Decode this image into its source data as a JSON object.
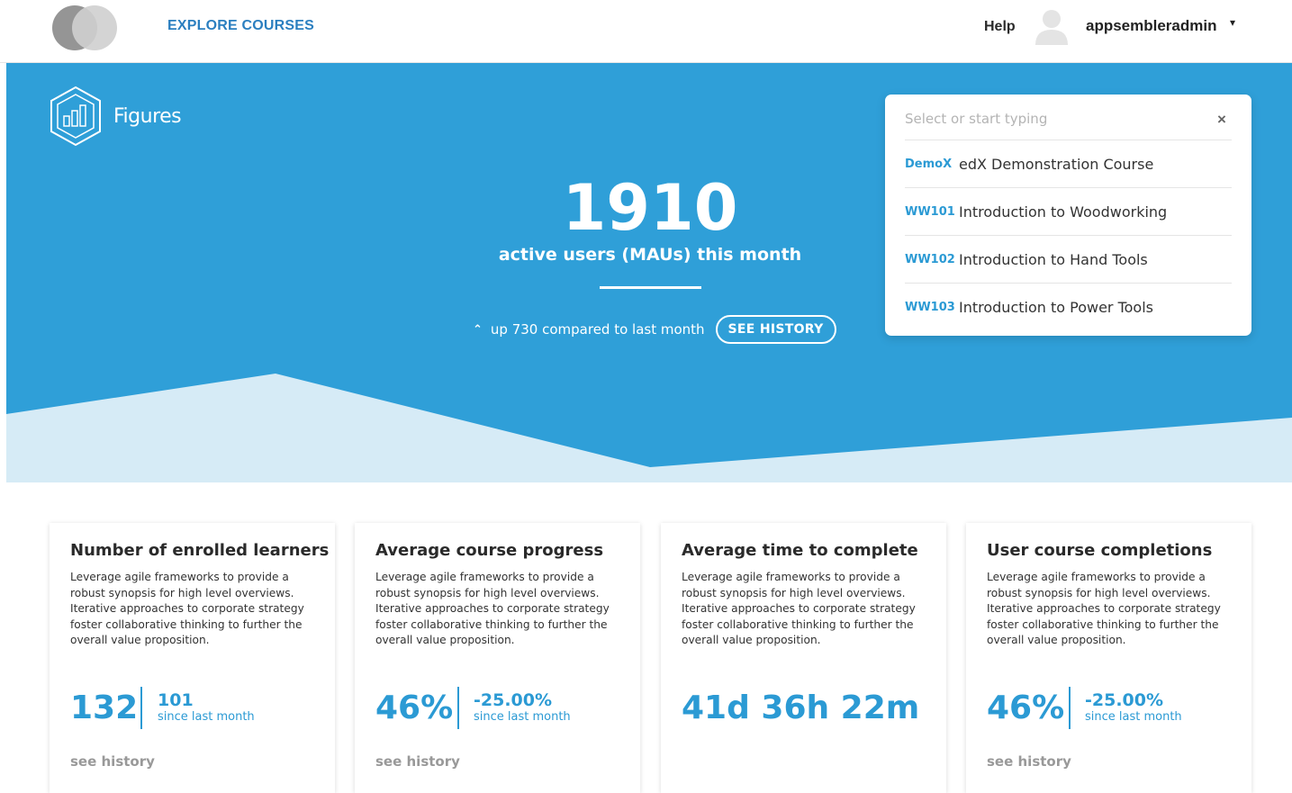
{
  "nav": {
    "explore": "EXPLORE COURSES",
    "help": "Help",
    "username": "appsembleradmin",
    "caret": "▾"
  },
  "hero": {
    "brand": "Figures",
    "mau_value": "1910",
    "mau_label": "active users (MAUs) this month",
    "compare_arrow": "⌃",
    "compare_text": "up 730 compared to last month",
    "see_history": "SEE HISTORY"
  },
  "course_select": {
    "placeholder": "Select or start typing",
    "close": "×",
    "items": [
      {
        "code": "DemoX",
        "name": "edX Demonstration Course"
      },
      {
        "code": "WW101",
        "name": "Introduction to Woodworking"
      },
      {
        "code": "WW102",
        "name": "Introduction to Hand Tools"
      },
      {
        "code": "WW103",
        "name": "Introduction to Power Tools"
      }
    ]
  },
  "cards": [
    {
      "title": "Number of enrolled learners",
      "desc": "Leverage agile frameworks to provide a robust synopsis for high level overviews. Iterative approaches to corporate strategy foster collaborative thinking to further the overall value proposition.",
      "value": "132",
      "delta": "101",
      "delta_label": "since last month",
      "history": "see history"
    },
    {
      "title": "Average course progress",
      "desc": "Leverage agile frameworks to provide a robust synopsis for high level overviews. Iterative approaches to corporate strategy foster collaborative thinking to further the overall value proposition.",
      "value": "46%",
      "delta": "-25.00%",
      "delta_label": "since last month",
      "history": "see history"
    },
    {
      "title": "Average time to complete",
      "desc": "Leverage agile frameworks to provide a robust synopsis for high level overviews. Iterative approaches to corporate strategy foster collaborative thinking to further the overall value proposition.",
      "value": "41d 36h 22m"
    },
    {
      "title": "User course completions",
      "desc": "Leverage agile frameworks to provide a robust synopsis for high level overviews. Iterative approaches to corporate strategy foster collaborative thinking to further the overall value proposition.",
      "value": "46%",
      "delta": "-25.00%",
      "delta_label": "since last month",
      "history": "see history"
    }
  ],
  "colors": {
    "hero_blue": "#2f9fd8",
    "hero_light": "#d6ebf6",
    "accent": "#2b9ad4"
  }
}
